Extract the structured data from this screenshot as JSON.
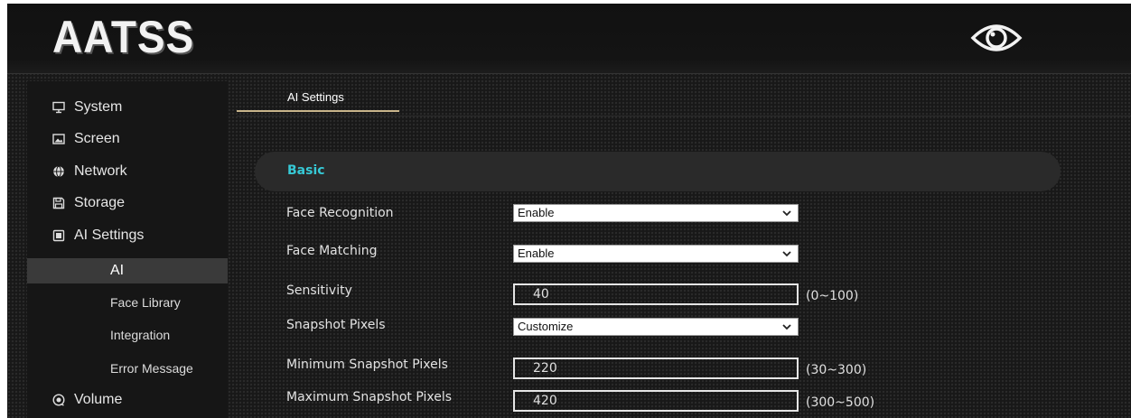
{
  "header": {
    "logo_text": "AATSS",
    "eye_icon": "eye-icon"
  },
  "sidebar": {
    "items": [
      {
        "label": "System",
        "icon": "monitor-icon"
      },
      {
        "label": "Screen",
        "icon": "image-icon"
      },
      {
        "label": "Network",
        "icon": "globe-icon"
      },
      {
        "label": "Storage",
        "icon": "floppy-icon"
      },
      {
        "label": "AI Settings",
        "icon": "chip-icon"
      },
      {
        "label": "Volume",
        "icon": "speaker-icon"
      }
    ],
    "sub_items": [
      {
        "label": "AI",
        "active": true
      },
      {
        "label": "Face Library"
      },
      {
        "label": "Integration"
      },
      {
        "label": "Error Message"
      }
    ]
  },
  "tabs": {
    "active_label": "AI Settings"
  },
  "section": {
    "title": "Basic"
  },
  "form": {
    "face_recognition": {
      "label": "Face Recognition",
      "value": "Enable"
    },
    "face_matching": {
      "label": "Face Matching",
      "value": "Enable"
    },
    "sensitivity": {
      "label": "Sensitivity",
      "value": "40",
      "range": "(0~100)"
    },
    "snapshot_pixels": {
      "label": "Snapshot Pixels",
      "value": "Customize"
    },
    "min_snapshot": {
      "label": "Minimum Snapshot Pixels",
      "value": "220",
      "range": "(30~300)"
    },
    "max_snapshot": {
      "label": "Maximum Snapshot Pixels",
      "value": "420",
      "range": "(300~500)"
    }
  },
  "colors": {
    "accent": "#36c9d6",
    "tab_underline": "#c8b48a"
  }
}
